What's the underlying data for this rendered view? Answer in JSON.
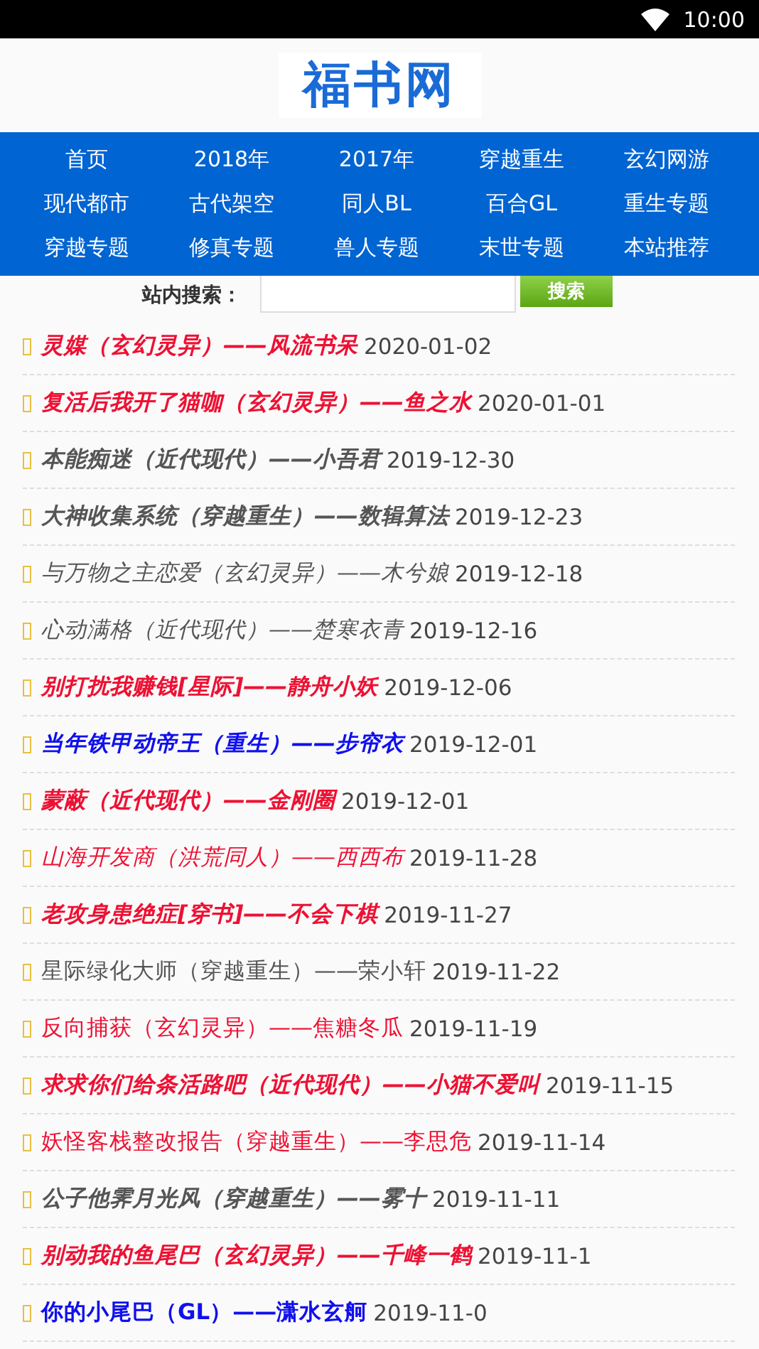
{
  "status_bar": {
    "time": "10:00"
  },
  "logo": "福书网",
  "nav": [
    "首页",
    "2018年",
    "2017年",
    "穿越重生",
    "玄幻网游",
    "现代都市",
    "古代架空",
    "同人BL",
    "百合GL",
    "重生专题",
    "穿越专题",
    "修真专题",
    "兽人专题",
    "末世专题",
    "本站推荐"
  ],
  "search": {
    "label": "站内搜索：",
    "button": "搜索"
  },
  "books": [
    {
      "title": "灵媒（玄幻灵异）——风流书呆",
      "date": "2020-01-02",
      "color": "#ee1133",
      "bold": true,
      "italic": true
    },
    {
      "title": "复活后我开了猫咖（玄幻灵异）——鱼之水",
      "date": "2020-01-01",
      "color": "#ee1133",
      "bold": true,
      "italic": true
    },
    {
      "title": "本能痴迷（近代现代）——小吾君",
      "date": "2019-12-30",
      "color": "#555555",
      "bold": true,
      "italic": true
    },
    {
      "title": "大神收集系统（穿越重生）——数辑算法",
      "date": "2019-12-23",
      "color": "#555555",
      "bold": true,
      "italic": true
    },
    {
      "title": "与万物之主恋爱（玄幻灵异）——木兮娘",
      "date": "2019-12-18",
      "color": "#555555",
      "bold": false,
      "italic": true
    },
    {
      "title": "心动满格（近代现代）——楚寒衣青",
      "date": "2019-12-16",
      "color": "#555555",
      "bold": false,
      "italic": true
    },
    {
      "title": "别打扰我赚钱[星际]——静舟小妖",
      "date": "2019-12-06",
      "color": "#ee1133",
      "bold": true,
      "italic": true
    },
    {
      "title": "当年铁甲动帝王（重生）——步帘衣",
      "date": "2019-12-01",
      "color": "#1010ee",
      "bold": true,
      "italic": true
    },
    {
      "title": "蒙蔽（近代现代）——金刚圈",
      "date": "2019-12-01",
      "color": "#ee1133",
      "bold": true,
      "italic": true
    },
    {
      "title": "山海开发商（洪荒同人）——西西布",
      "date": "2019-11-28",
      "color": "#ee1133",
      "bold": false,
      "italic": true
    },
    {
      "title": "老攻身患绝症[穿书]——不会下棋",
      "date": "2019-11-27",
      "color": "#ee1133",
      "bold": true,
      "italic": true
    },
    {
      "title": "星际绿化大师（穿越重生）——荣小轩",
      "date": "2019-11-22",
      "color": "#555555",
      "bold": false,
      "italic": false
    },
    {
      "title": "反向捕获（玄幻灵异）——焦糖冬瓜",
      "date": "2019-11-19",
      "color": "#ee1133",
      "bold": false,
      "italic": false
    },
    {
      "title": "求求你们给条活路吧（近代现代）——小猫不爱叫",
      "date": "2019-11-15",
      "color": "#ee1133",
      "bold": true,
      "italic": true
    },
    {
      "title": "妖怪客栈整改报告（穿越重生）——李思危",
      "date": "2019-11-14",
      "color": "#ee1133",
      "bold": false,
      "italic": false
    },
    {
      "title": "公子他霁月光风（穿越重生）——雾十",
      "date": "2019-11-11",
      "color": "#555555",
      "bold": true,
      "italic": true
    },
    {
      "title": "别动我的鱼尾巴（玄幻灵异）——千峰一鹤",
      "date": "2019-11-1",
      "color": "#ee1133",
      "bold": true,
      "italic": true
    },
    {
      "title": "你的小尾巴（GL）——潇水玄舸",
      "date": "2019-11-0",
      "color": "#1010ee",
      "bold": true,
      "italic": false
    }
  ]
}
